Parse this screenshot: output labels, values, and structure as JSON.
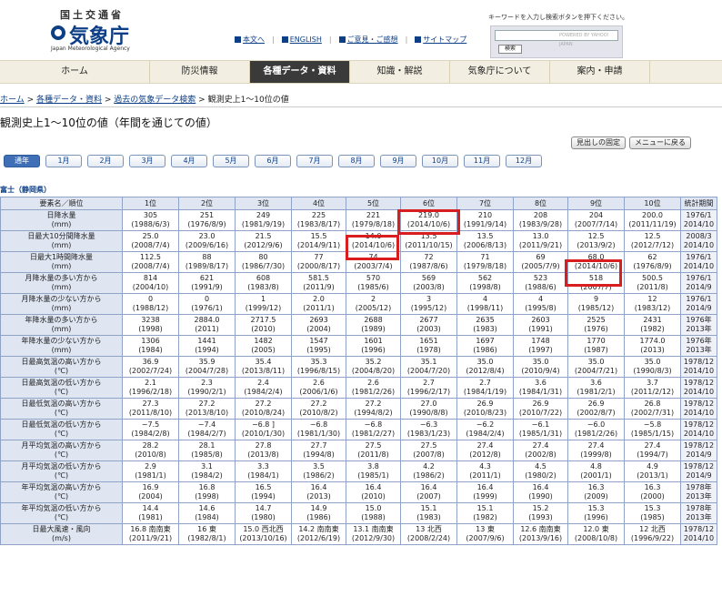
{
  "header": {
    "agency_kanji_top": "国土交通省",
    "agency_name": "気象庁",
    "agency_english": "Japan Meteorological Agency",
    "links": [
      "本文へ",
      "ENGLISH",
      "ご意見・ご感想",
      "サイトマップ"
    ],
    "search_hint": "キーワードを入力し検索ボタンを押下ください。",
    "search_placeholder": "POWERED BY YAHOO! JAPAN",
    "search_button": "検索"
  },
  "nav": [
    "ホーム",
    "防災情報",
    "各種データ・資料",
    "知識・解説",
    "気象庁について",
    "案内・申請"
  ],
  "nav_active_index": 2,
  "breadcrumb": [
    "ホーム",
    "各種データ・資料",
    "過去の気象データ検索",
    "観測史上1〜10位の値"
  ],
  "page_title": "観測史上1〜10位の値（年間を通じての値）",
  "util_buttons": [
    "見出しの固定",
    "メニューに戻る"
  ],
  "months": [
    "通年",
    "1月",
    "2月",
    "3月",
    "4月",
    "5月",
    "6月",
    "7月",
    "8月",
    "9月",
    "10月",
    "11月",
    "12月"
  ],
  "station": "富士（静岡県）",
  "table": {
    "headers": [
      "要素名／順位",
      "1位",
      "2位",
      "3位",
      "4位",
      "5位",
      "6位",
      "7位",
      "8位",
      "9位",
      "10位",
      "統計期間"
    ],
    "rows": [
      {
        "label": [
          "日降水量",
          "(mm)"
        ],
        "cells": [
          [
            "305",
            "(1988/6/3)"
          ],
          [
            "251",
            "(1976/8/9)"
          ],
          [
            "249",
            "(1981/9/19)"
          ],
          [
            "225",
            "(1983/8/17)"
          ],
          [
            "221",
            "(1979/8/18)"
          ],
          [
            "219.0",
            "(2014/10/6)"
          ],
          [
            "210",
            "(1991/9/14)"
          ],
          [
            "208",
            "(1983/9/28)"
          ],
          [
            "204",
            "(2007/7/14)"
          ],
          [
            "200.0",
            "(2011/11/19)"
          ]
        ],
        "period": [
          "1976/1",
          "2014/10"
        ]
      },
      {
        "label": [
          "日最大10分間降水量",
          "(mm)"
        ],
        "cells": [
          [
            "25.0",
            "(2008/7/4)"
          ],
          [
            "23.0",
            "(2009/6/16)"
          ],
          [
            "21.5",
            "(2012/9/6)"
          ],
          [
            "15.5",
            "(2014/9/11)"
          ],
          [
            "14.0",
            "(2014/10/6)"
          ],
          [
            "13.5",
            "(2011/10/15)"
          ],
          [
            "13.5",
            "(2006/8/13)"
          ],
          [
            "13.0",
            "(2011/9/21)"
          ],
          [
            "12.5",
            "(2013/9/2)"
          ],
          [
            "12.5",
            "(2012/7/12)"
          ]
        ],
        "period": [
          "2008/3",
          "2014/10"
        ]
      },
      {
        "label": [
          "日最大1時間降水量",
          "(mm)"
        ],
        "cells": [
          [
            "112.5",
            "(2008/7/4)"
          ],
          [
            "88",
            "(1989/8/17)"
          ],
          [
            "80",
            "(1986/7/30)"
          ],
          [
            "77",
            "(2000/8/17)"
          ],
          [
            "74",
            "(2003/7/4)"
          ],
          [
            "72",
            "(1987/8/6)"
          ],
          [
            "71",
            "(1979/8/18)"
          ],
          [
            "69",
            "(2005/7/9)"
          ],
          [
            "68.0",
            "(2014/10/6)"
          ],
          [
            "62",
            "(1976/8/9)"
          ]
        ],
        "period": [
          "1976/1",
          "2014/10"
        ]
      },
      {
        "label": [
          "月降水量の多い方から",
          "(mm)"
        ],
        "cells": [
          [
            "814",
            "(2004/10)"
          ],
          [
            "621",
            "(1991/9)"
          ],
          [
            "608",
            "(1983/8)"
          ],
          [
            "581.5",
            "(2011/9)"
          ],
          [
            "570",
            "(1985/6)"
          ],
          [
            "569",
            "(2003/8)"
          ],
          [
            "562",
            "(1998/8)"
          ],
          [
            "523",
            "(1988/6)"
          ],
          [
            "518",
            "(2007/7)"
          ],
          [
            "500.5",
            "(2011/8)"
          ]
        ],
        "period": [
          "1976/1",
          "2014/9"
        ]
      },
      {
        "label": [
          "月降水量の少ない方から",
          "(mm)"
        ],
        "cells": [
          [
            "0",
            "(1988/12)"
          ],
          [
            "0",
            "(1976/1)"
          ],
          [
            "1",
            "(1999/12)"
          ],
          [
            "2.0",
            "(2011/1)"
          ],
          [
            "2",
            "(2005/12)"
          ],
          [
            "3",
            "(1995/12)"
          ],
          [
            "4",
            "(1998/11)"
          ],
          [
            "4",
            "(1995/8)"
          ],
          [
            "9",
            "(1985/12)"
          ],
          [
            "12",
            "(1983/12)"
          ]
        ],
        "period": [
          "1976/1",
          "2014/9"
        ]
      },
      {
        "label": [
          "年降水量の多い方から",
          "(mm)"
        ],
        "cells": [
          [
            "3238",
            "(1998)"
          ],
          [
            "2884.0",
            "(2011)"
          ],
          [
            "2717.5",
            "(2010)"
          ],
          [
            "2693",
            "(2004)"
          ],
          [
            "2688",
            "(1989)"
          ],
          [
            "2677",
            "(2003)"
          ],
          [
            "2635",
            "(1983)"
          ],
          [
            "2603",
            "(1991)"
          ],
          [
            "2525",
            "(1976)"
          ],
          [
            "2431",
            "(1982)"
          ]
        ],
        "period": [
          "1976年",
          "2013年"
        ]
      },
      {
        "label": [
          "年降水量の少ない方から",
          "(mm)"
        ],
        "cells": [
          [
            "1306",
            "(1984)"
          ],
          [
            "1441",
            "(1994)"
          ],
          [
            "1482",
            "(2005)"
          ],
          [
            "1547",
            "(1995)"
          ],
          [
            "1601",
            "(1996)"
          ],
          [
            "1651",
            "(1978)"
          ],
          [
            "1697",
            "(1986)"
          ],
          [
            "1748",
            "(1997)"
          ],
          [
            "1770",
            "(1987)"
          ],
          [
            "1774.0",
            "(2013)"
          ]
        ],
        "period": [
          "1976年",
          "2013年"
        ]
      },
      {
        "label": [
          "日最高気温の高い方から",
          "(℃)"
        ],
        "cells": [
          [
            "36.9",
            "(2002/7/24)"
          ],
          [
            "35.9",
            "(2004/7/28)"
          ],
          [
            "35.4",
            "(2013/8/11)"
          ],
          [
            "35.3",
            "(1996/8/15)"
          ],
          [
            "35.2",
            "(2004/8/20)"
          ],
          [
            "35.1",
            "(2004/7/20)"
          ],
          [
            "35.0",
            "(2012/8/4)"
          ],
          [
            "35.0",
            "(2010/9/4)"
          ],
          [
            "35.0",
            "(2004/7/21)"
          ],
          [
            "35.0",
            "(1990/8/3)"
          ]
        ],
        "period": [
          "1978/12",
          "2014/10"
        ]
      },
      {
        "label": [
          "日最高気温の低い方から",
          "(℃)"
        ],
        "cells": [
          [
            "2.1",
            "(1996/2/18)"
          ],
          [
            "2.3",
            "(1990/2/1)"
          ],
          [
            "2.4",
            "(1984/2/4)"
          ],
          [
            "2.6",
            "(2006/1/6)"
          ],
          [
            "2.6",
            "(1981/2/26)"
          ],
          [
            "2.7",
            "(1996/2/17)"
          ],
          [
            "2.7",
            "(1984/1/19)"
          ],
          [
            "3.6",
            "(1984/1/31)"
          ],
          [
            "3.6",
            "(1981/2/1)"
          ],
          [
            "3.7",
            "(2011/2/12)"
          ]
        ],
        "period": [
          "1978/12",
          "2014/10"
        ]
      },
      {
        "label": [
          "日最低気温の高い方から",
          "(℃)"
        ],
        "cells": [
          [
            "27.3",
            "(2011/8/10)"
          ],
          [
            "27.2",
            "(2013/8/10)"
          ],
          [
            "27.2",
            "(2010/8/24)"
          ],
          [
            "27.2",
            "(2010/8/2)"
          ],
          [
            "27.2",
            "(1994/8/2)"
          ],
          [
            "27.0",
            "(1990/8/8)"
          ],
          [
            "26.9",
            "(2010/8/23)"
          ],
          [
            "26.9",
            "(2010/7/22)"
          ],
          [
            "26.9",
            "(2002/8/7)"
          ],
          [
            "26.8",
            "(2002/7/31)"
          ]
        ],
        "period": [
          "1978/12",
          "2014/10"
        ]
      },
      {
        "label": [
          "日最低気温の低い方から",
          "(℃)"
        ],
        "cells": [
          [
            "−7.5",
            "(1984/2/8)"
          ],
          [
            "−7.4",
            "(1984/2/7)"
          ],
          [
            "−6.8 ]",
            "(2010/1/30)"
          ],
          [
            "−6.8",
            "(1981/1/30)"
          ],
          [
            "−6.8",
            "(1981/2/27)"
          ],
          [
            "−6.3",
            "(1983/1/23)"
          ],
          [
            "−6.2",
            "(1984/2/4)"
          ],
          [
            "−6.1",
            "(1985/1/31)"
          ],
          [
            "−6.0",
            "(1981/2/26)"
          ],
          [
            "−5.8",
            "(1985/1/15)"
          ]
        ],
        "period": [
          "1978/12",
          "2014/10"
        ]
      },
      {
        "label": [
          "月平均気温の高い方から",
          "(℃)"
        ],
        "cells": [
          [
            "28.2",
            "(2010/8)"
          ],
          [
            "28.1",
            "(1985/8)"
          ],
          [
            "27.8",
            "(2013/8)"
          ],
          [
            "27.7",
            "(1994/8)"
          ],
          [
            "27.5",
            "(2011/8)"
          ],
          [
            "27.5",
            "(2007/8)"
          ],
          [
            "27.4",
            "(2012/8)"
          ],
          [
            "27.4",
            "(2002/8)"
          ],
          [
            "27.4",
            "(1999/8)"
          ],
          [
            "27.4",
            "(1994/7)"
          ]
        ],
        "period": [
          "1978/12",
          "2014/9"
        ]
      },
      {
        "label": [
          "月平均気温の低い方から",
          "(℃)"
        ],
        "cells": [
          [
            "2.9",
            "(1981/1)"
          ],
          [
            "3.1",
            "(1984/2)"
          ],
          [
            "3.3",
            "(1984/1)"
          ],
          [
            "3.5",
            "(1986/2)"
          ],
          [
            "3.8",
            "(1985/1)"
          ],
          [
            "4.2",
            "(1986/2)"
          ],
          [
            "4.3",
            "(2011/1)"
          ],
          [
            "4.5",
            "(1980/2)"
          ],
          [
            "4.8",
            "(2001/1)"
          ],
          [
            "4.9",
            "(2013/1)"
          ]
        ],
        "period": [
          "1978/12",
          "2014/9"
        ]
      },
      {
        "label": [
          "年平均気温の高い方から",
          "(℃)"
        ],
        "cells": [
          [
            "16.9",
            "(2004)"
          ],
          [
            "16.8",
            "(1998)"
          ],
          [
            "16.5",
            "(1994)"
          ],
          [
            "16.4",
            "(2013)"
          ],
          [
            "16.4",
            "(2010)"
          ],
          [
            "16.4",
            "(2007)"
          ],
          [
            "16.4",
            "(1999)"
          ],
          [
            "16.4",
            "(1990)"
          ],
          [
            "16.3",
            "(2009)"
          ],
          [
            "16.3",
            "(2000)"
          ]
        ],
        "period": [
          "1978年",
          "2013年"
        ]
      },
      {
        "label": [
          "年平均気温の低い方から",
          "(℃)"
        ],
        "cells": [
          [
            "14.4",
            "(1981)"
          ],
          [
            "14.6",
            "(1984)"
          ],
          [
            "14.7",
            "(1980)"
          ],
          [
            "14.9",
            "(1986)"
          ],
          [
            "15.0",
            "(1988)"
          ],
          [
            "15.1",
            "(1983)"
          ],
          [
            "15.1",
            "(1982)"
          ],
          [
            "15.2",
            "(1993)"
          ],
          [
            "15.3",
            "(1996)"
          ],
          [
            "15.3",
            "(1985)"
          ]
        ],
        "period": [
          "1978年",
          "2013年"
        ]
      },
      {
        "label": [
          "日最大風速・風向",
          "(m/s)"
        ],
        "cells": [
          [
            "16.8 南南東",
            "(2011/9/21)"
          ],
          [
            "16 東",
            "(1982/8/1)"
          ],
          [
            "15.0 西北西",
            "(2013/10/16)"
          ],
          [
            "14.2 南南東",
            "(2012/6/19)"
          ],
          [
            "13.1 南南東",
            "(2012/9/30)"
          ],
          [
            "13 北西",
            "(2008/2/24)"
          ],
          [
            "13 東",
            "(2007/9/6)"
          ],
          [
            "12.6 南南東",
            "(2013/9/16)"
          ],
          [
            "12.0 東",
            "(2008/10/8)"
          ],
          [
            "12 北西",
            "(1996/9/22)"
          ]
        ],
        "period": [
          "1978/12",
          "2014/10"
        ]
      }
    ]
  },
  "highlight_color": "#d81e1e",
  "accent_color": "#0d3f86"
}
